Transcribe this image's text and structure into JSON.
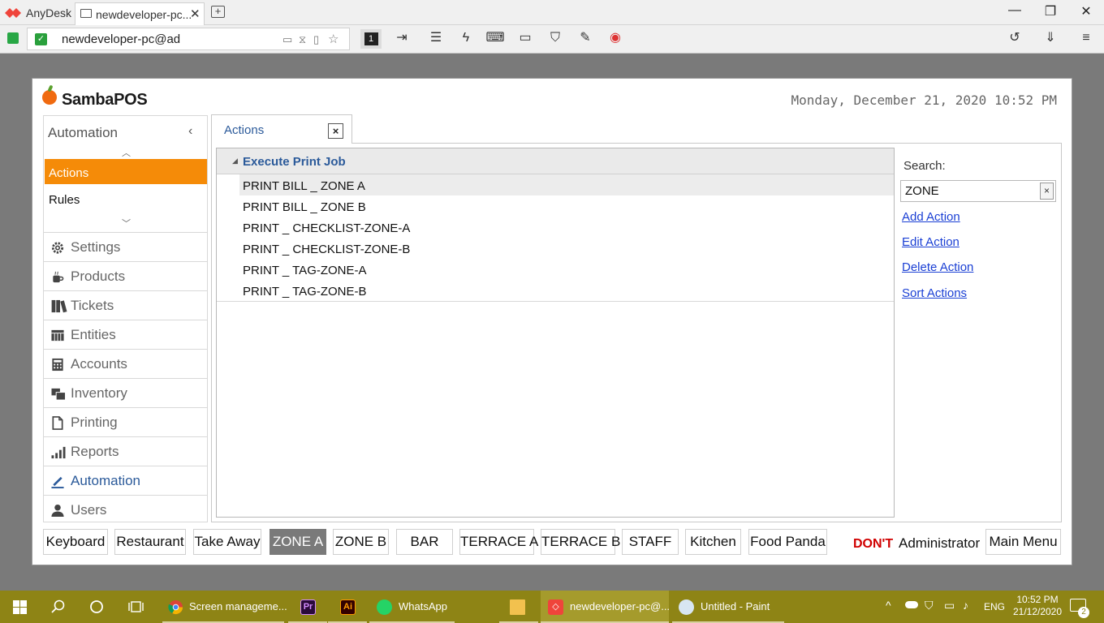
{
  "anydesk": {
    "app_name": "AnyDesk",
    "tab_title": "newdeveloper-pc...",
    "address": "newdeveloper-pc@ad",
    "monitor_number": "1",
    "brand_color": "#ef443b"
  },
  "samba": {
    "title": "SambaPOS",
    "datetime": "Monday, December 21, 2020 10:52 PM",
    "accent_color": "#f58b08"
  },
  "nav": {
    "header": "Automation",
    "collapse_glyph": "‹",
    "sub_items": [
      "Actions",
      "Rules"
    ],
    "items": [
      {
        "label": "Settings",
        "icon": "gear-icon"
      },
      {
        "label": "Products",
        "icon": "coffee-cup-icon"
      },
      {
        "label": "Tickets",
        "icon": "books-icon"
      },
      {
        "label": "Entities",
        "icon": "table-icon"
      },
      {
        "label": "Accounts",
        "icon": "calculator-icon"
      },
      {
        "label": "Inventory",
        "icon": "boxes-icon"
      },
      {
        "label": "Printing",
        "icon": "document-icon"
      },
      {
        "label": "Reports",
        "icon": "bar-chart-icon"
      },
      {
        "label": "Automation",
        "icon": "pen-icon"
      },
      {
        "label": "Users",
        "icon": "user-icon"
      }
    ]
  },
  "tab": {
    "label": "Actions",
    "close": "×"
  },
  "list": {
    "group": "Execute Print Job",
    "rows": [
      "PRINT BILL _ ZONE A",
      "PRINT BILL _ ZONE B",
      "PRINT _ CHECKLIST-ZONE-A",
      "PRINT _ CHECKLIST-ZONE-B",
      "PRINT _ TAG-ZONE-A",
      "PRINT _ TAG-ZONE-B"
    ]
  },
  "search": {
    "label": "Search:",
    "value": "ZONE",
    "clear": "×"
  },
  "side_links": [
    "Add Action",
    "Edit Action",
    "Delete Action",
    "Sort Actions"
  ],
  "bottom_bar": {
    "buttons": [
      "Keyboard",
      "Restaurant",
      "Take Away",
      "ZONE A",
      "ZONE B",
      "BAR",
      "TERRACE A",
      "TERRACE B",
      "STAFF",
      "Kitchen",
      "Food Panda"
    ],
    "active": "ZONE A",
    "warning": "DON'T",
    "user": "Administrator",
    "main_menu": "Main Menu"
  },
  "taskbar": {
    "apps": [
      {
        "label": "Screen manageme...",
        "icon": "chrome-icon"
      },
      {
        "label": "",
        "icon": "premiere-icon"
      },
      {
        "label": "",
        "icon": "illustrator-icon"
      },
      {
        "label": "WhatsApp",
        "icon": "whatsapp-icon"
      },
      {
        "label": "",
        "icon": "file-explorer-icon"
      },
      {
        "label": "newdeveloper-pc@...",
        "icon": "anydesk-icon"
      },
      {
        "label": "Untitled - Paint",
        "icon": "paint-icon"
      }
    ],
    "lang": "ENG",
    "time": "10:52 PM",
    "date": "21/12/2020",
    "notifications": "2"
  }
}
